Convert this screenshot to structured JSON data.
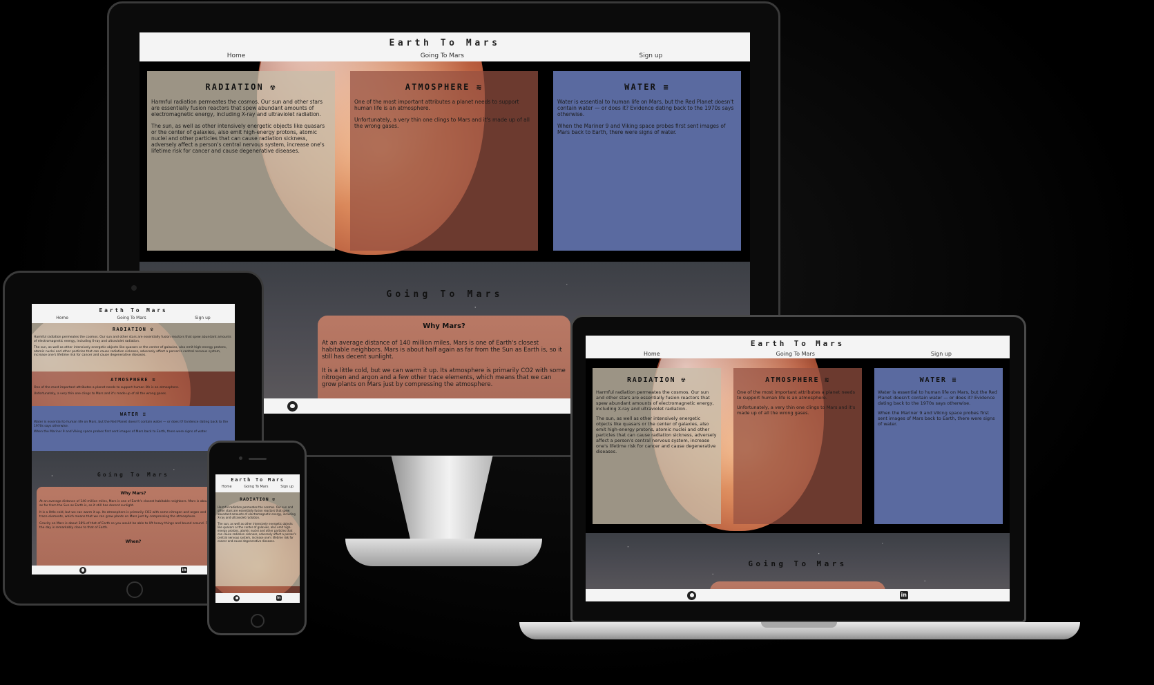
{
  "site": {
    "title": "Earth To Mars",
    "nav": [
      "Home",
      "Going To Mars",
      "Sign up"
    ]
  },
  "cards": {
    "radiation": {
      "title": "RADIATION ☢",
      "p1": "Harmful radiation permeates the cosmos. Our sun and other stars are essentially fusion reactors that spew abundant amounts of electromagnetic energy, including X-ray and ultraviolet radiation.",
      "p2": "The sun, as well as other intensively energetic objects like quasars or the center of galaxies, also emit high-energy protons, atomic nuclei and other particles that can cause radiation sickness, adversely affect a person's central nervous system, increase one's lifetime risk for cancer and cause degenerative diseases."
    },
    "atmosphere": {
      "title": "ATMOSPHERE ≋",
      "p1": "One of the most important attributes a planet needs to support human life is an atmosphere.",
      "p2": "Unfortunately, a very thin one clings to Mars and it's made up of all the wrong gases."
    },
    "water": {
      "title": "WATER ≡",
      "p1": "Water is essential to human life on Mars, but the Red Planet doesn't contain water — or does it? Evidence dating back to the 1970s says otherwise.",
      "p2": "When the Mariner 9 and Viking space probes first sent images of Mars back to Earth, there were signs of water."
    }
  },
  "going": {
    "title": "Going To Mars",
    "why_title": "Why Mars?",
    "why_p1": "At an average distance of 140 million miles, Mars is one of Earth's closest habitable neighbors. Mars is about half again as far from the Sun as Earth is, so it still has decent sunlight.",
    "why_p2": "It is a little cold, but we can warm it up. Its atmosphere is primarily CO2 with some nitrogen and argon and a few other trace elements, which means that we can grow plants on Mars just by compressing the atmosphere.",
    "why_p3": "Gravity on Mars is about 38% of that of Earth so you would be able to lift heavy things and bound around. Furthermore, the day is remarkably close to that of Earth.",
    "when_title": "When?"
  },
  "footer": {
    "github_icon": "github-icon",
    "linkedin_icon": "linkedin-icon",
    "linkedin_glyph": "in"
  },
  "colors": {
    "background": "#000000",
    "header": "#f4f4f4",
    "radiation_card": "#c8beaa",
    "atmosphere_card": "#965041",
    "water_card": "#5a6aa0"
  }
}
